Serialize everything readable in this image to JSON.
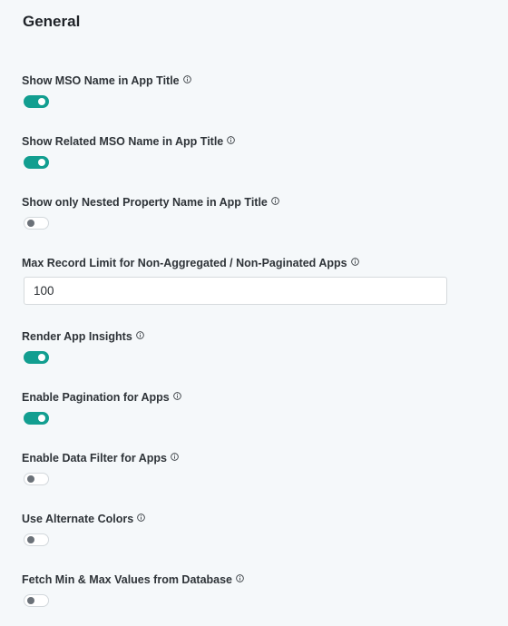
{
  "section": {
    "title": "General"
  },
  "settings": [
    {
      "label": "Show MSO Name in App Title",
      "type": "toggle",
      "enabled": true
    },
    {
      "label": "Show Related MSO Name in App Title",
      "type": "toggle",
      "enabled": true
    },
    {
      "label": "Show only Nested Property Name in App Title",
      "type": "toggle",
      "enabled": false
    },
    {
      "label": "Max Record Limit for Non-Aggregated / Non-Paginated Apps",
      "type": "number",
      "value": "100"
    },
    {
      "label": "Render App Insights",
      "type": "toggle",
      "enabled": true
    },
    {
      "label": "Enable Pagination for Apps",
      "type": "toggle",
      "enabled": true
    },
    {
      "label": "Enable Data Filter for Apps",
      "type": "toggle",
      "enabled": false
    },
    {
      "label": "Use Alternate Colors",
      "type": "toggle",
      "enabled": false
    },
    {
      "label": "Fetch Min & Max Values from Database",
      "type": "toggle",
      "enabled": false
    }
  ],
  "icons": {
    "info": "info-circle-icon"
  },
  "colors": {
    "toggle_on": "#129e90",
    "toggle_off_knob": "#6b7178",
    "background": "#f5f8fa"
  }
}
